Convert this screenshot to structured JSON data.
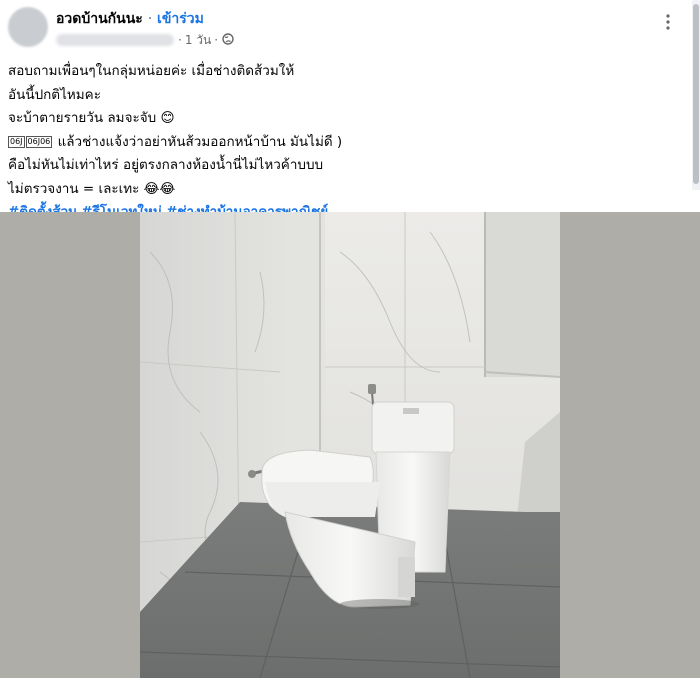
{
  "post": {
    "group_name": "อวดบ้านกันนะ",
    "separator": "·",
    "join_label": "เข้าร่วม",
    "time_label": "1 วัน",
    "lines": [
      "สอบถามเพื่อนๆในกลุ่มหน่อยค่ะ เมื่อช่างติดส้วมให้",
      "อันนี้ปกติไหมคะ",
      "จะบ้าตายรายวัน ลมจะจับ 😊",
      "แล้วช่างแจ้งว่าอย่าหันส้วมออกหน้าบ้าน มันไม่ดี )",
      "คือไม่หันไม่เท่าไหร่ อยู่ตรงกลางห้องน้ำนี่ไม่ไหวค้าบบบ",
      "ไม่ตรวจงาน = เละเทะ 😂😂"
    ],
    "code_boxes": [
      "06J",
      "06J06"
    ],
    "hashtags": [
      "#ติดตั้งส้วม",
      "#รีโนเวทใหม่",
      "#ช่างทำบ้านอาคารพาณิชย์"
    ]
  },
  "icons": {
    "globe": "globe-icon",
    "more": "more-options-icon"
  },
  "colors": {
    "link": "#1b74e4",
    "meta": "#65676b",
    "photo_backdrop": "#afada7"
  }
}
